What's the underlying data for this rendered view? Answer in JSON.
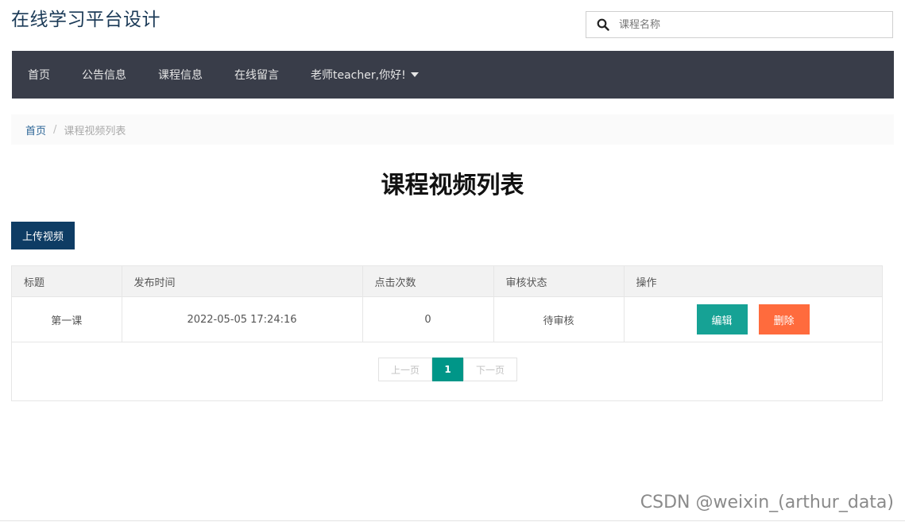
{
  "site": {
    "title": "在线学习平台设计"
  },
  "search": {
    "placeholder": "课程名称",
    "icon": "search-icon"
  },
  "nav": {
    "items": [
      "首页",
      "公告信息",
      "课程信息",
      "在线留言"
    ],
    "user_menu": "老师teacher,你好!"
  },
  "breadcrumb": {
    "home": "首页",
    "separator": "/",
    "current": "课程视频列表"
  },
  "page": {
    "title": "课程视频列表",
    "upload_label": "上传视频"
  },
  "table": {
    "headers": [
      "标题",
      "发布时间",
      "点击次数",
      "审核状态",
      "操作"
    ],
    "rows": [
      {
        "title": "第一课",
        "time": "2022-05-05 17:24:16",
        "clicks": "0",
        "status": "待审核",
        "edit": "编辑",
        "delete": "删除"
      }
    ]
  },
  "pagination": {
    "prev": "上一页",
    "current": "1",
    "next": "下一页"
  },
  "watermark": "CSDN @weixin_(arthur_data)",
  "colors": {
    "nav_bg": "#393d49",
    "primary": "#0e3c64",
    "edit": "#16a295",
    "delete": "#ff6b3d",
    "page_active": "#009688"
  }
}
